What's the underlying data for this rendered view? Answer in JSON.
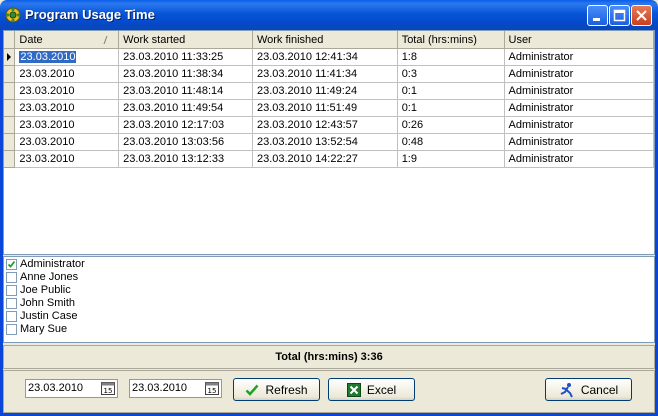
{
  "window": {
    "title": "Program Usage Time"
  },
  "grid": {
    "columns": [
      "Date",
      "Work started",
      "Work finished",
      "Total (hrs:mins)",
      "User"
    ],
    "rows": [
      [
        "23.03.2010",
        "23.03.2010 11:33:25",
        "23.03.2010 12:41:34",
        "1:8",
        "Administrator"
      ],
      [
        "23.03.2010",
        "23.03.2010 11:38:34",
        "23.03.2010 11:41:34",
        "0:3",
        "Administrator"
      ],
      [
        "23.03.2010",
        "23.03.2010 11:48:14",
        "23.03.2010 11:49:24",
        "0:1",
        "Administrator"
      ],
      [
        "23.03.2010",
        "23.03.2010 11:49:54",
        "23.03.2010 11:51:49",
        "0:1",
        "Administrator"
      ],
      [
        "23.03.2010",
        "23.03.2010 12:17:03",
        "23.03.2010 12:43:57",
        "0:26",
        "Administrator"
      ],
      [
        "23.03.2010",
        "23.03.2010 13:03:56",
        "23.03.2010 13:52:54",
        "0:48",
        "Administrator"
      ],
      [
        "23.03.2010",
        "23.03.2010 13:12:33",
        "23.03.2010 14:22:27",
        "1:9",
        "Administrator"
      ]
    ]
  },
  "users": [
    {
      "name": "Administrator",
      "checked": true
    },
    {
      "name": "Anne Jones",
      "checked": false
    },
    {
      "name": "Joe Public",
      "checked": false
    },
    {
      "name": "John Smith",
      "checked": false
    },
    {
      "name": "Justin Case",
      "checked": false
    },
    {
      "name": "Mary Sue",
      "checked": false
    }
  ],
  "total": {
    "text": "Total (hrs:mins) 3:36"
  },
  "filters": {
    "date_from": "23.03.2010",
    "date_to": "23.03.2010",
    "calendar_day": "15"
  },
  "buttons": {
    "refresh": "Refresh",
    "excel": "Excel",
    "cancel": "Cancel"
  },
  "icons": {
    "app": "gear-icon",
    "minimize": "minimize-icon",
    "maximize": "maximize-icon",
    "close": "close-icon",
    "refresh": "checkmark-icon",
    "excel": "excel-icon",
    "cancel": "cancel-figure-icon",
    "calendar": "calendar-icon"
  }
}
